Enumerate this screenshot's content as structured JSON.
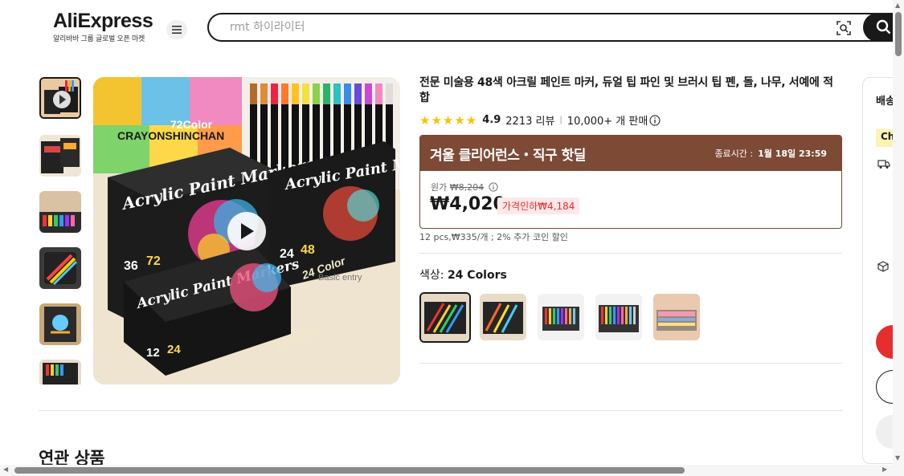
{
  "header": {
    "logo": "AliExpress",
    "logo_sub": "알리바바 그룹 글로벌 오픈 마켓",
    "search_placeholder": "rmt 하이라이터",
    "icons": [
      "menu-icon",
      "image-search-icon",
      "search-icon"
    ]
  },
  "gallery": {
    "overlay_text_72": "72Color",
    "overlay_text_24": "24 Color",
    "overlay_text_entry": "Basic entry",
    "overlay_text_12": "12Color",
    "box_title": "Acrylic Paint Markers",
    "counts_big": [
      "36",
      "72"
    ],
    "counts_mid": [
      "24",
      "48"
    ],
    "counts_small": [
      "12",
      "24"
    ],
    "crayon_poster": "CRAYONSHINCHAN"
  },
  "product": {
    "title": "전문 미술용 48색 아크릴 페인트 마커, 듀얼 팁 파인 및 브러시 팁 펜, 돌, 나무, 서예에 적합",
    "rating": "4.9",
    "reviews": "2213 리뷰",
    "separator": "|",
    "sold": "10,000+ 개 판매",
    "deal_name": "겨울 클리어런스・직구 핫딜",
    "deal_end_label": "종료시간 :",
    "deal_end_time": "1월 18일 23:59",
    "original_label": "원가",
    "original_price": "₩8,204",
    "price": "₩4,020",
    "discount": "가격인하₩4,184",
    "unit_info": "12 pcs,₩335/개 ; 2% 추가 코인 할인",
    "color_label": "색상:",
    "color_value": "24 Colors"
  },
  "related": {
    "title": "연관 상품"
  },
  "side_panel": {
    "label": "배송",
    "badge": "Ch"
  },
  "colors": {
    "brand_red": "#e62e2e",
    "deal_brown": "#7d4a36",
    "star": "#fcc100"
  }
}
